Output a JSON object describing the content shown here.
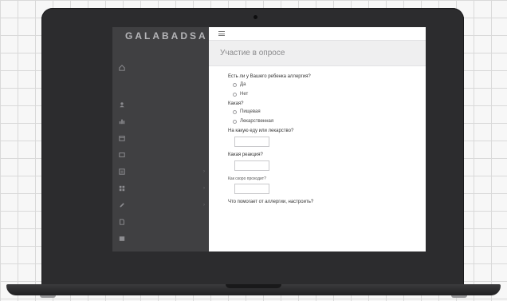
{
  "app": {
    "brand": "GALABADSA"
  },
  "sidebar": {
    "sections": [
      "",
      ""
    ],
    "items": [
      {
        "label": "",
        "icon": "home-icon"
      },
      {
        "label": "",
        "icon": "user-icon"
      },
      {
        "label": "",
        "icon": "chart-icon"
      },
      {
        "label": "",
        "icon": "calendar-icon"
      },
      {
        "label": "",
        "icon": "message-icon"
      },
      {
        "label": "",
        "icon": "list-icon"
      },
      {
        "label": "",
        "icon": "grid-icon"
      },
      {
        "label": "",
        "icon": "edit-icon"
      },
      {
        "label": "",
        "icon": "document-icon"
      },
      {
        "label": "",
        "icon": "image-icon"
      }
    ]
  },
  "page": {
    "title": "Участие в опросе"
  },
  "form": {
    "q1": {
      "label": "Есть ли у Вашего ребенка аллергия?",
      "options": [
        "Да",
        "Нет"
      ]
    },
    "q2": {
      "label": "Какая?",
      "options": [
        "Пищевая",
        "Лекарственная"
      ]
    },
    "q3": {
      "label": "На какую еду или лекарство?",
      "value": ""
    },
    "q4": {
      "label": "Какая реакция?",
      "value": ""
    },
    "q5": {
      "label": "Как скоро проходит?",
      "value": ""
    },
    "q6": {
      "label": "Что помогает от аллергии, настроить?"
    }
  }
}
